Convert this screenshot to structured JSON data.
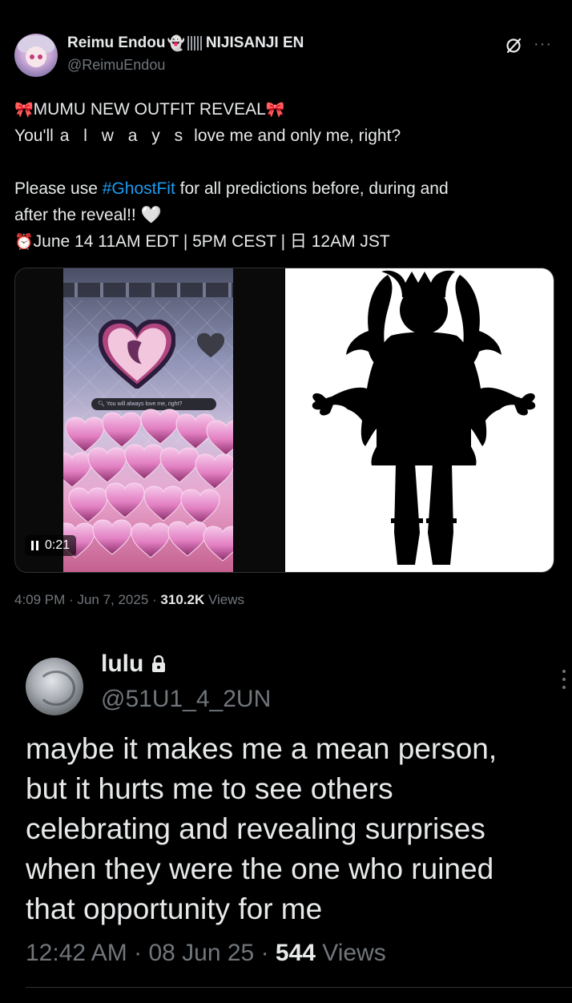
{
  "post": {
    "display_name": "Reimu Endou",
    "name_emoji": "👻",
    "name_suffix": "NIJISANJI EN",
    "handle": "@ReimuEndou",
    "more_label": "···",
    "bow_emoji": "🎀",
    "clock_emoji": "⏰",
    "heart_emoji": "🤍",
    "line1_text": "MUMU NEW OUTFIT REVEAL",
    "line2_start": "You'll",
    "line2_spaced": "a l w a y s",
    "line2_end": "love me and only me, right?",
    "line3_start": "Please use ",
    "hashtag": "#GhostFit",
    "line3_end": " for all predictions before, during and",
    "line4": "after the reveal!!",
    "line5": "June 14 11AM EDT | 5PM CEST | 日 12AM JST",
    "video": {
      "overlay_search_text": "You will always love me, right?",
      "duration": "0:21"
    },
    "time": "4:09 PM",
    "date": "Jun 7, 2025",
    "views_count": "310.2K",
    "views_label": "Views"
  },
  "quoted": {
    "display_name": "lulu",
    "handle": "@51U1_4_2UN",
    "text_lines": [
      "maybe it makes me a mean person,",
      "but it hurts me to see others",
      "celebrating and revealing surprises",
      "when they were the one who ruined",
      "that opportunity for me"
    ],
    "time": "12:42 AM",
    "date": "08 Jun 25",
    "views_count": "544",
    "views_label": "Views"
  },
  "colors": {
    "background": "#000000",
    "text": "#e7e9ea",
    "muted": "#71767b",
    "link": "#1d9bf0",
    "accent_red": "#e0245e"
  }
}
